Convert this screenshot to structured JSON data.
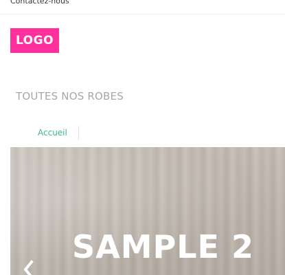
{
  "topbar": {
    "contact_label": "Contactez-nous"
  },
  "header": {
    "logo_text": "LOGO",
    "logo_color": "#ff2f9b"
  },
  "page": {
    "title": "TOUTES NOS ROBES"
  },
  "breadcrumb": {
    "home_label": "Accueil",
    "link_color": "#3fb68f"
  },
  "slider": {
    "slide_title": "SAMPLE 2",
    "prev_icon": "chevron-left-icon"
  }
}
